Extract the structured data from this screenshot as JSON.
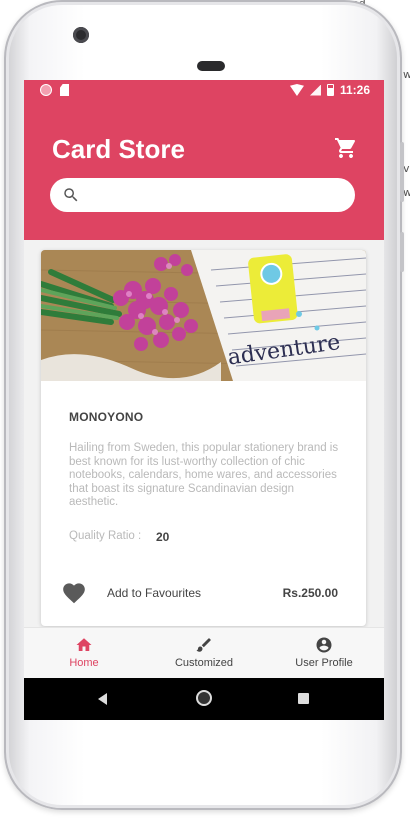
{
  "edge_fragments": [
    "ed",
    "w",
    "v",
    "w"
  ],
  "status_bar": {
    "time": "11:26"
  },
  "app_bar": {
    "title": "Card Store",
    "search_placeholder": ""
  },
  "product": {
    "name": "MONOYONO",
    "description": "Hailing from Sweden, this popular stationery brand is best known for its lust-worthy collection of chic notebooks, calendars, home wares, and accessories that boast its signature Scandinavian design aesthetic.",
    "quality_label": "Quality Ratio :",
    "quality_value": "20",
    "favourite_label": "Add to Favourites",
    "price": "Rs.250.00",
    "image_text": "adventure"
  },
  "bottom_nav": {
    "items": [
      {
        "label": "Home",
        "icon": "home-icon",
        "active": true
      },
      {
        "label": "Customized",
        "icon": "brush-icon",
        "active": false
      },
      {
        "label": "User Profile",
        "icon": "account-circle-icon",
        "active": false
      }
    ]
  },
  "colors": {
    "primary": "#de4462",
    "text": "#444444",
    "muted": "#b9b9b9"
  }
}
